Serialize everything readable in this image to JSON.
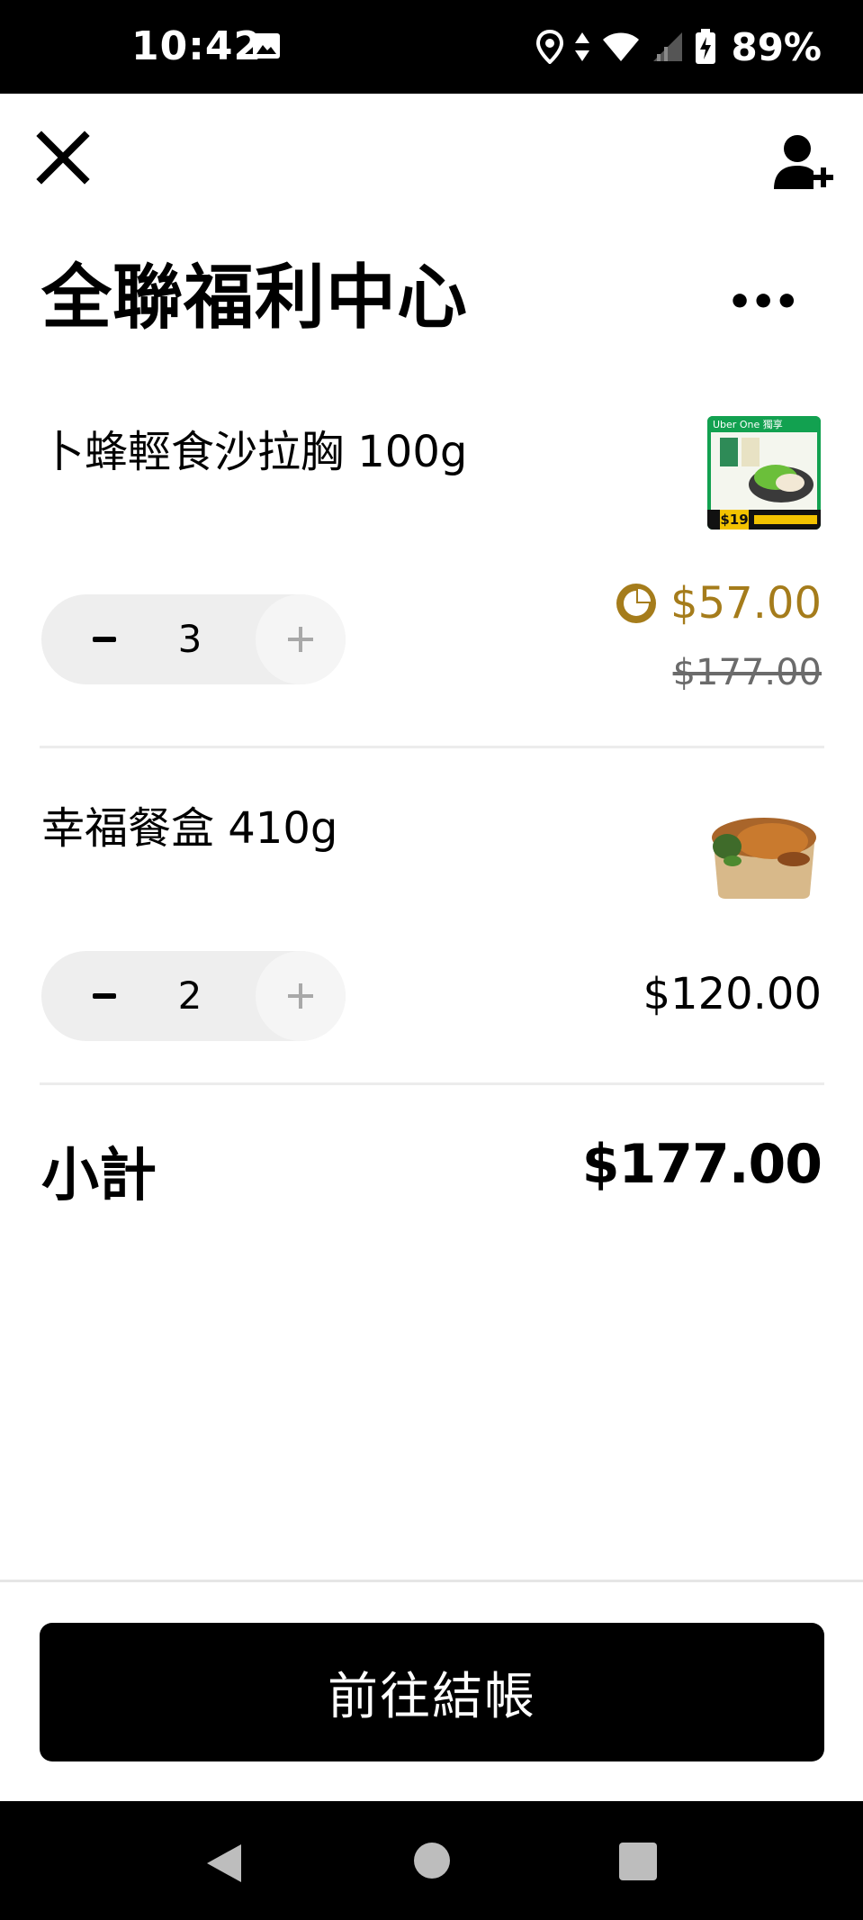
{
  "status_bar": {
    "time": "10:42",
    "battery_percent": "89%",
    "icons": [
      "image-icon",
      "location-icon",
      "data-arrows-icon",
      "wifi-icon",
      "signal-icon",
      "battery-charging-icon"
    ]
  },
  "header": {
    "close_icon": "close-icon",
    "add_person_icon": "add-person-icon",
    "store_title": "全聯福利中心",
    "title_overflow": "•••"
  },
  "cart": {
    "items": [
      {
        "name": "卜蜂輕食沙拉胸 100g",
        "quantity": "3",
        "promo_icon": "uber-one-icon",
        "price": "$57.00",
        "original_price": "$177.00",
        "thumbnail": {
          "badge_text": "Uber One 獨享",
          "price_tag": "$19"
        }
      },
      {
        "name": "幸福餐盒 410g",
        "quantity": "2",
        "price": "$120.00",
        "thumbnail": "food-box-image"
      }
    ],
    "subtotal_label": "小計",
    "subtotal_value": "$177.00"
  },
  "footer": {
    "checkout_label": "前往結帳"
  },
  "colors": {
    "promo": "#a57c1b",
    "thumb_green": "#12a150",
    "background": "#ffffff",
    "button": "#000000"
  }
}
